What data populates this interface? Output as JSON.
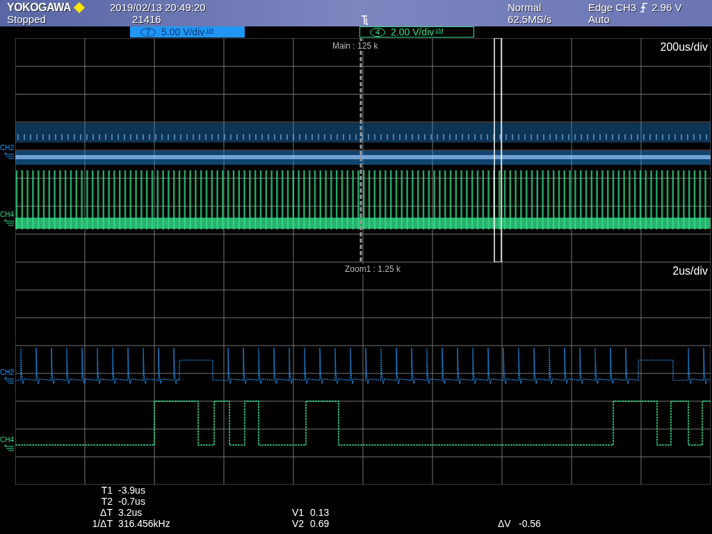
{
  "header": {
    "brand": "YOKOGAWA",
    "status": "Stopped",
    "datetime": "2019/02/13 20:49:20",
    "count": "21416",
    "mode": "Normal",
    "sample_rate": "62.5MS/s",
    "trigger_source": "Edge CH3",
    "trigger_level": "2.96 V",
    "trigger_mode": "Auto"
  },
  "channels": [
    {
      "number": "2",
      "scale": "5.00 V/div",
      "impedance": "1M",
      "color": "#2196f3",
      "selected": true
    },
    {
      "number": "4",
      "scale": "2.00 V/div",
      "impedance": "1M",
      "color": "#33dd88",
      "selected": false
    }
  ],
  "main": {
    "label": "Main :",
    "record": "125 k",
    "timebase": "200us/div",
    "trace_labels": [
      "CH2",
      "CH4"
    ]
  },
  "zoom": {
    "label": "Zoom1 :",
    "record": "1.25 k",
    "timebase": "2us/div",
    "trace_labels": [
      "CH2",
      "CH4"
    ]
  },
  "cursors": {
    "time": [
      {
        "label": "T1",
        "value": "-3.9us"
      },
      {
        "label": "T2",
        "value": "-0.7us"
      },
      {
        "label": "ΔT",
        "value": "3.2us"
      },
      {
        "label": "1/ΔT",
        "value": "316.456kHz"
      }
    ],
    "voltage": [
      {
        "label": "V1",
        "value": "0.13"
      },
      {
        "label": "V2",
        "value": "0.69"
      }
    ],
    "delta": {
      "label": "ΔV",
      "value": "-0.56"
    }
  }
}
